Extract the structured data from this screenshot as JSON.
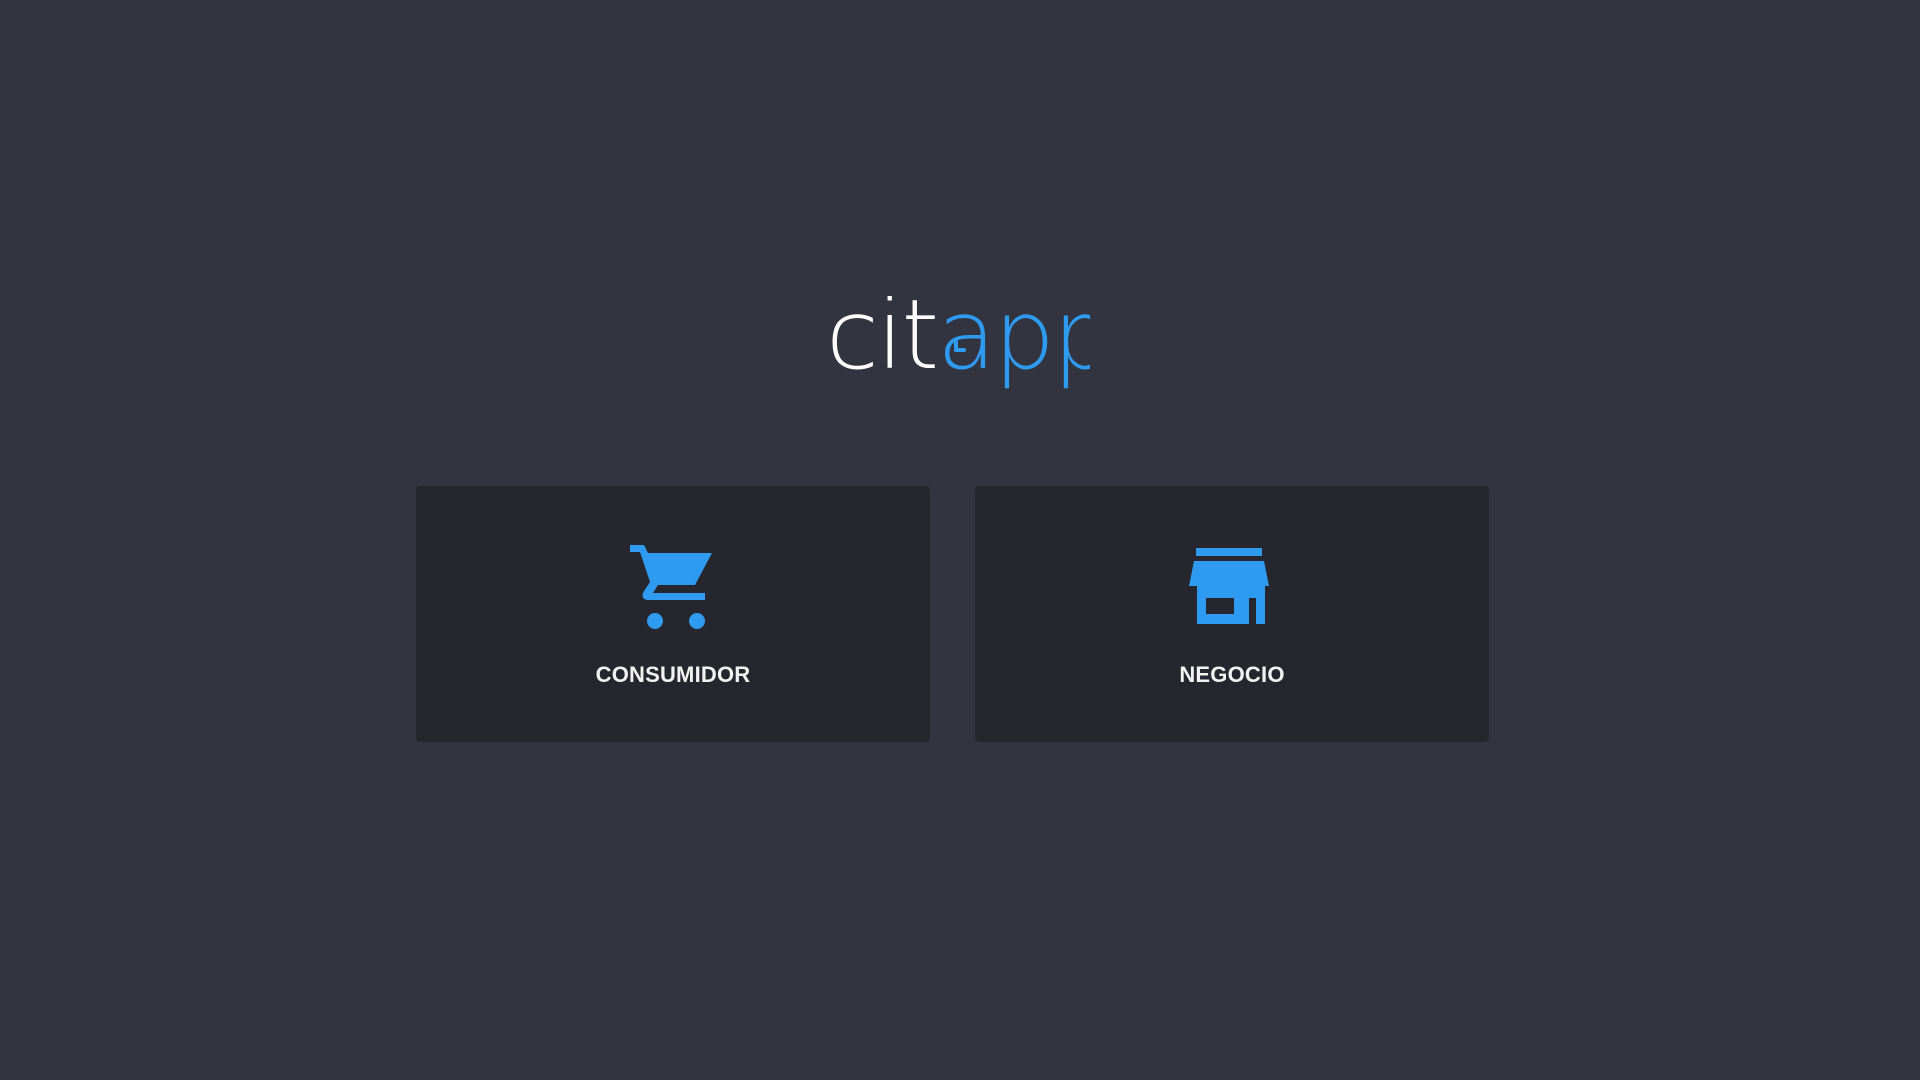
{
  "app": {
    "logo_prefix": "cit",
    "logo_suffix": "app",
    "logo_icon": "clock-icon"
  },
  "options": [
    {
      "label": "CONSUMIDOR",
      "icon": "shopping-cart-icon"
    },
    {
      "label": "NEGOCIO",
      "icon": "storefront-icon"
    }
  ],
  "colors": {
    "background": "#32353f",
    "card": "#25262e",
    "accent": "#2f9bf0",
    "text": "#f2f2f2"
  }
}
